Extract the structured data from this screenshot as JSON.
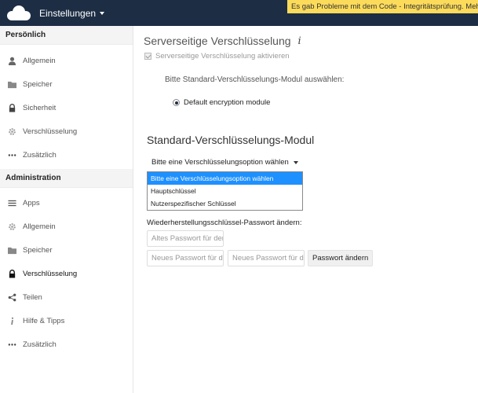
{
  "header": {
    "app_title": "Einstellungen",
    "logo_icon": "owncloud-logo-icon",
    "warning": "Es gab Probleme mit dem Code - Integritätsprüfung. Mehr"
  },
  "sidebar": {
    "personal_heading": "Persönlich",
    "personal_items": [
      {
        "label": "Allgemein",
        "icon": "user-icon"
      },
      {
        "label": "Speicher",
        "icon": "folder-icon"
      },
      {
        "label": "Sicherheit",
        "icon": "lock-icon"
      },
      {
        "label": "Verschlüsselung",
        "icon": "gear-icon"
      },
      {
        "label": "Zusätzlich",
        "icon": "more-icon"
      }
    ],
    "admin_heading": "Administration",
    "admin_items": [
      {
        "label": "Apps",
        "icon": "list-icon"
      },
      {
        "label": "Allgemein",
        "icon": "gear-icon"
      },
      {
        "label": "Speicher",
        "icon": "folder-icon"
      },
      {
        "label": "Verschlüsselung",
        "icon": "lock-icon",
        "active": true
      },
      {
        "label": "Teilen",
        "icon": "share-icon"
      },
      {
        "label": "Hilfe & Tipps",
        "icon": "info-icon"
      },
      {
        "label": "Zusätzlich",
        "icon": "more-icon"
      }
    ]
  },
  "main": {
    "title": "Serverseitige Verschlüsselung",
    "info_glyph": "i",
    "enable_checkbox_label": "Serverseitige Verschlüsselung aktivieren",
    "enable_checked": true,
    "select_module_label": "Bitte Standard-Verschlüsselungs-Modul auswählen:",
    "module_option": "Default encryption module",
    "module_heading": "Standard-Verschlüsselungs-Modul",
    "dropdown_label": "Bitte eine Verschlüsselungsoption wählen",
    "dropdown_options": [
      "Bitte eine Verschlüsselungsoption wählen",
      "Hauptschlüssel",
      "Nutzerspezifischer Schlüssel"
    ],
    "recovery_label": "Wiederherstellungsschlüssel-Passwort ändern:",
    "old_password_placeholder": "Altes Passwort für den",
    "new_password_placeholder": "Neues Passwort für d",
    "repeat_password_placeholder": "Neues Passwort für d",
    "change_password_button": "Passwort ändern"
  },
  "colors": {
    "header_bg": "#1d2d44",
    "warning_bg": "#fcdb5b",
    "dropdown_selected": "#1e90ff"
  }
}
